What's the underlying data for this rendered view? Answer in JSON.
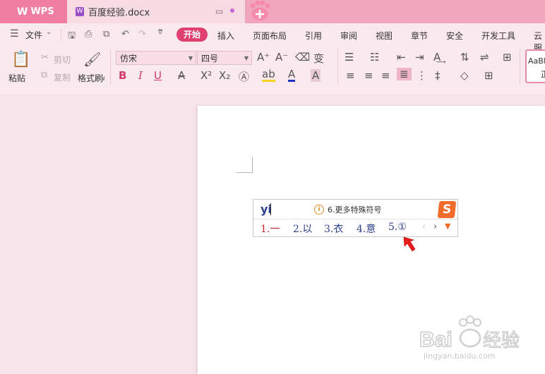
{
  "titlebar": {
    "app_tab": "WPS",
    "doc_tab": "百度经验.docx"
  },
  "ribbon": {
    "file_menu": "文件",
    "tabs": [
      "开始",
      "插入",
      "页面布局",
      "引用",
      "审阅",
      "视图",
      "章节",
      "安全",
      "开发工具",
      "云服"
    ],
    "clipboard": {
      "paste": "粘贴",
      "cut": "剪切",
      "copy": "复制",
      "format_painter": "格式刷"
    },
    "font": {
      "family": "仿宋",
      "size": "四号"
    },
    "style_preview": "AaBl",
    "style_label": "正"
  },
  "ime": {
    "input": "yi",
    "tip_number": "6.",
    "tip": "更多特殊符号",
    "candidates": [
      {
        "num": "1.",
        "text": "一"
      },
      {
        "num": "2.",
        "text": "以"
      },
      {
        "num": "3.",
        "text": "衣"
      },
      {
        "num": "4.",
        "text": "意"
      },
      {
        "num": "5.",
        "text": "①"
      }
    ]
  },
  "watermark": {
    "brand": "Bai",
    "brand_cn": "经验",
    "url": "jingyan.baidu.com"
  },
  "colors": {
    "titlebar": "#f2a6bd",
    "accent": "#e0406f",
    "ribbon_bg": "#fae9ef",
    "workspace_bg": "#f6e4ea",
    "ime_text": "#2b3f8d",
    "ime_first": "#c4232b",
    "sogou": "#f16b2b"
  }
}
